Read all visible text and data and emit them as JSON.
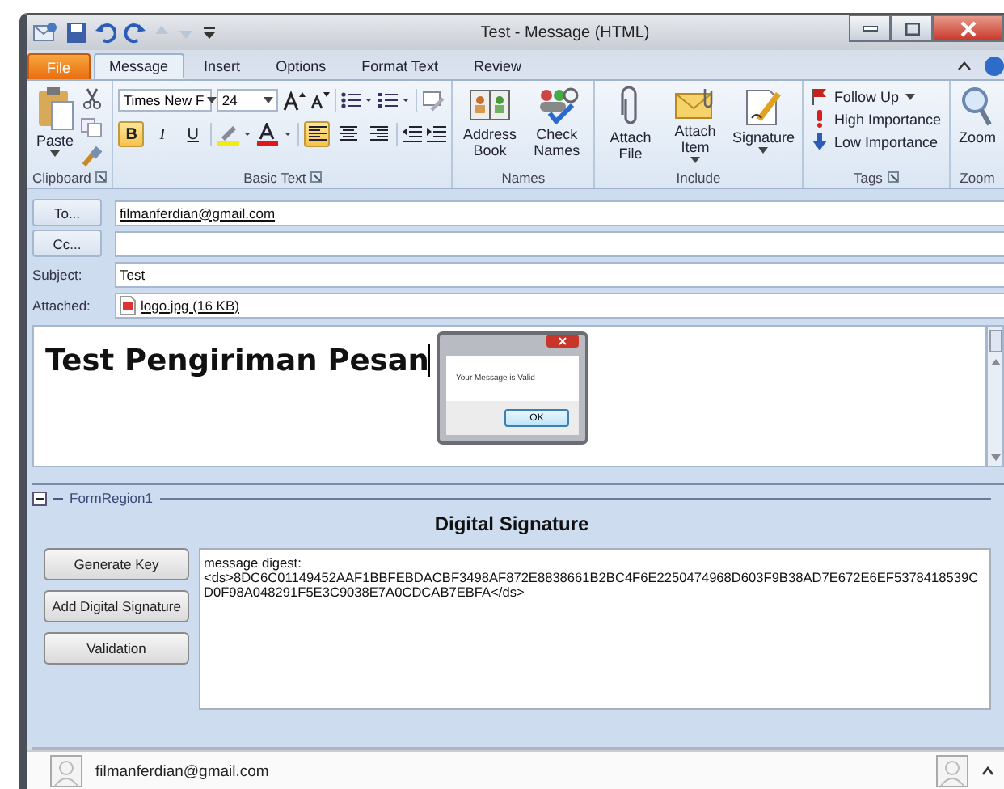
{
  "window": {
    "title": "Test  -  Message (HTML)"
  },
  "tabs": [
    {
      "label": "File",
      "kind": "file",
      "selected": false
    },
    {
      "label": "Message",
      "kind": "tab",
      "selected": true
    },
    {
      "label": "Insert",
      "kind": "tab",
      "selected": false
    },
    {
      "label": "Options",
      "kind": "tab",
      "selected": false
    },
    {
      "label": "Format Text",
      "kind": "tab",
      "selected": false
    },
    {
      "label": "Review",
      "kind": "tab",
      "selected": false
    }
  ],
  "ribbon": {
    "clipboard": {
      "name": "Clipboard",
      "launcher": true,
      "paste": "Paste"
    },
    "basic_text": {
      "name": "Basic Text",
      "launcher": true,
      "font": "Times New F",
      "size": "24",
      "format": [
        {
          "label": "B",
          "selected": true
        },
        {
          "label": "I",
          "selected": false
        },
        {
          "label": "U",
          "selected": false
        }
      ],
      "align": [
        {
          "kind": "left",
          "selected": true
        },
        {
          "kind": "center",
          "selected": false
        },
        {
          "kind": "right",
          "selected": false
        }
      ]
    },
    "names": {
      "name": "Names",
      "launcher": false,
      "buttons": [
        {
          "label": "Address Book",
          "kind": "book",
          "dropdown": false
        },
        {
          "label": "Check Names",
          "kind": "people",
          "dropdown": false
        }
      ]
    },
    "include": {
      "name": "Include",
      "launcher": false,
      "buttons": [
        {
          "label": "Attach File",
          "kind": "clip",
          "dropdown": false
        },
        {
          "label": "Attach Item",
          "kind": "envelope",
          "dropdown": true
        },
        {
          "label": "Signature",
          "kind": "pen",
          "dropdown": true
        }
      ]
    },
    "tags": {
      "name": "Tags",
      "launcher": true,
      "items": [
        {
          "label": "Follow Up",
          "kind": "flag",
          "dropdown": true
        },
        {
          "label": "High Importance",
          "kind": "high",
          "dropdown": false
        },
        {
          "label": "Low Importance",
          "kind": "low",
          "dropdown": false
        }
      ]
    },
    "zoom": {
      "name": "Zoom",
      "launcher": false,
      "button": "Zoom"
    }
  },
  "fields": [
    {
      "kind": "button",
      "label": "To...",
      "value": "filmanferdian@gmail.com"
    },
    {
      "kind": "button",
      "label": "Cc..."
    },
    {
      "kind": "label",
      "label": "Subject:",
      "value": "Test"
    },
    {
      "kind": "attachment",
      "label": "Attached:",
      "value": "logo.jpg (16 KB)"
    }
  ],
  "body": {
    "text": "Test Pengiriman Pesan"
  },
  "dialog": {
    "message": "Your Message is Valid",
    "button": "OK"
  },
  "form_region": {
    "title": "FormRegion1",
    "heading": "Digital Signature",
    "buttons": [
      "Generate Key",
      "Add Digital Signature",
      "Validation"
    ],
    "output": [
      "message digest:",
      "<ds>8DC6C01149452AAF1BBFEBDACBF3498AF872E8838661B2BC4F6E2250474968D603F9B38AD7E672E6EF5378418539CD0F98A048291F5E3C9038E7A0CDCAB7EBFA</ds>"
    ]
  },
  "people_pane": {
    "email": "filmanferdian@gmail.com"
  }
}
